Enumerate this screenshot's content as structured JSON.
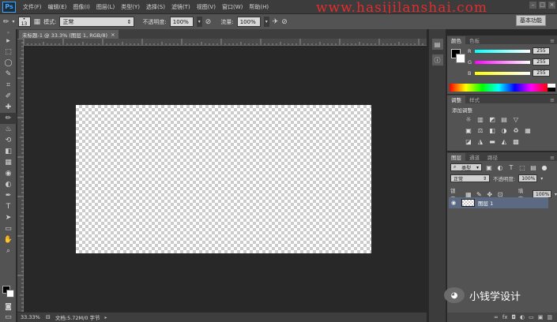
{
  "app": {
    "logo": "Ps"
  },
  "menu": [
    "文件(F)",
    "编辑(E)",
    "图像(I)",
    "图层(L)",
    "类型(Y)",
    "选择(S)",
    "滤镜(T)",
    "视图(V)",
    "窗口(W)",
    "帮助(H)"
  ],
  "watermark": "www.hasijilanshai.com",
  "workspace_button": "基本功能",
  "window_controls": [
    "–",
    "□",
    "×"
  ],
  "options": {
    "brush_size": "13",
    "mode_label": "模式:",
    "mode_value": "正常",
    "opacity_label": "不透明度:",
    "opacity_value": "100%",
    "flow_label": "流量:",
    "flow_value": "100%"
  },
  "document": {
    "tab_title": "未标题-1 @ 33.3% (图层 1, RGB/8)",
    "tab_close": "×",
    "zoom": "33.33%",
    "doc_info": "文档:5.72M/0 字节"
  },
  "tools": [
    "move-icon",
    "marquee-icon",
    "lasso-icon",
    "quick-select-icon",
    "crop-icon",
    "eyedropper-icon",
    "healing-icon",
    "brush-icon",
    "clone-stamp-icon",
    "history-brush-icon",
    "eraser-icon",
    "gradient-icon",
    "blur-icon",
    "dodge-icon",
    "pen-icon",
    "type-icon",
    "path-select-icon",
    "shape-icon",
    "hand-icon",
    "zoom-icon"
  ],
  "tool_glyphs": [
    "▸",
    "⬚",
    "◯",
    "✎",
    "⌗",
    "✐",
    "✚",
    "✏",
    "♨",
    "⟲",
    "◧",
    "▦",
    "◉",
    "◐",
    "✒",
    "T",
    "➤",
    "▭",
    "✋",
    "⌕"
  ],
  "color_panel": {
    "tabs": [
      "颜色",
      "色板"
    ],
    "rows": [
      {
        "label": "R",
        "value": "255",
        "gradient": "linear-gradient(90deg,#00ffff,#ffffff)"
      },
      {
        "label": "G",
        "value": "255",
        "gradient": "linear-gradient(90deg,#ff00ff,#ffffff)"
      },
      {
        "label": "B",
        "value": "255",
        "gradient": "linear-gradient(90deg,#ffff00,#ffffff)"
      }
    ]
  },
  "adjustments_panel": {
    "tabs": [
      "调整",
      "样式"
    ],
    "title": "添加调整",
    "row1": [
      "☼",
      "▥",
      "◩",
      "▤",
      "▽"
    ],
    "row2": [
      "▣",
      "⚖",
      "◧",
      "◑",
      "♻",
      "▦"
    ],
    "row3": [
      "◪",
      "◮",
      "▬",
      "◭",
      "▩"
    ]
  },
  "layers_panel": {
    "tabs": [
      "图层",
      "通道",
      "路径"
    ],
    "filter_type": "类型",
    "blend_mode": "正常",
    "opacity_label": "不透明度:",
    "opacity_value": "100%",
    "lock_label": "锁定:",
    "fill_label": "填充:",
    "fill_value": "100%",
    "layers": [
      {
        "name": "图层 1",
        "visible": true
      }
    ]
  },
  "wechat": {
    "name": "小钱学设计"
  }
}
